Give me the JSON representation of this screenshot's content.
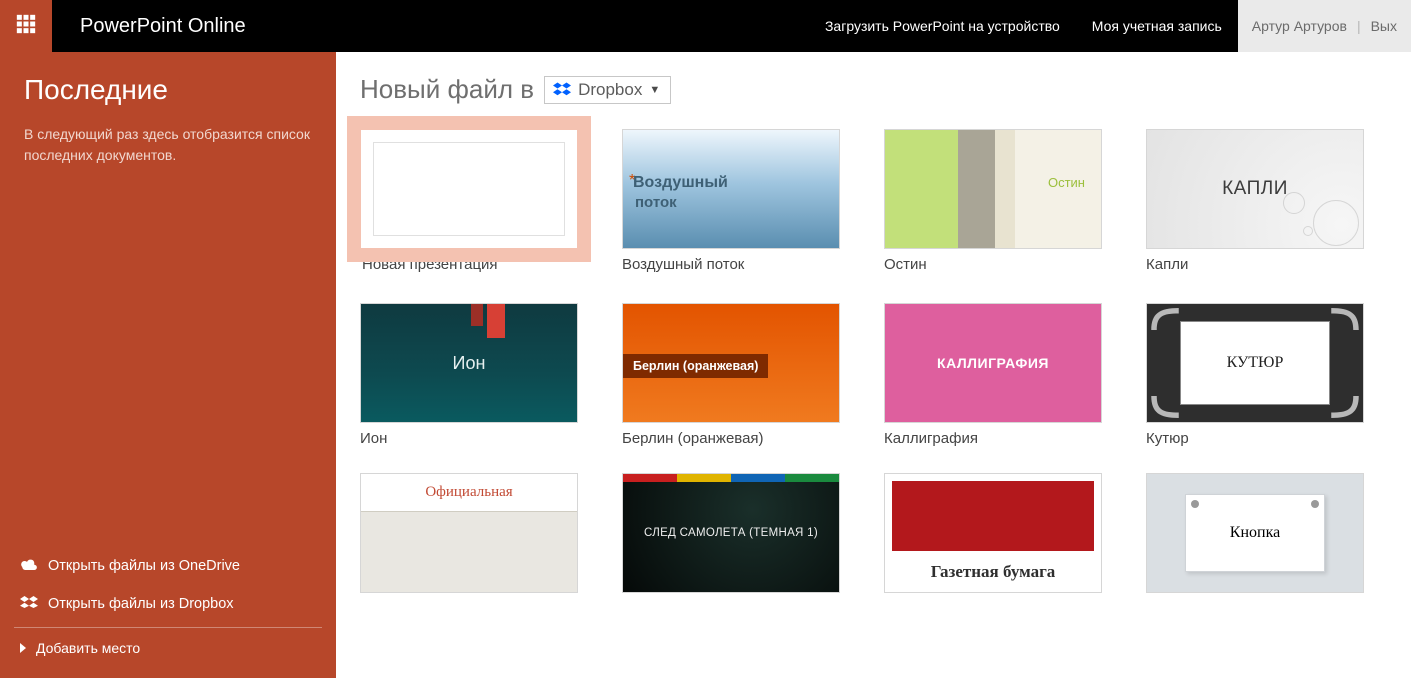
{
  "topbar": {
    "app_title": "PowerPoint Online",
    "download_link": "Загрузить PowerPoint на устройство",
    "account_link": "Моя учетная запись",
    "user_name": "Артур Артуров",
    "exit": "Вых"
  },
  "sidebar": {
    "recent_title": "Последние",
    "recent_message": "В следующий раз здесь отобразится список последних документов.",
    "open_onedrive": "Открыть файлы из OneDrive",
    "open_dropbox": "Открыть файлы из Dropbox",
    "add_place": "Добавить место"
  },
  "main": {
    "new_file_in": "Новый файл в",
    "location": "Dropbox"
  },
  "templates": [
    {
      "id": "blank",
      "label": "Новая презентация",
      "thumb_text": ""
    },
    {
      "id": "air",
      "label": "Воздушный поток",
      "thumb_text": "Воздушный поток",
      "thumb_text2": "поток",
      "asterisk": "*"
    },
    {
      "id": "austin",
      "label": "Остин",
      "thumb_text": "Остин"
    },
    {
      "id": "drops",
      "label": "Капли",
      "thumb_text": "КАПЛИ"
    },
    {
      "id": "ion",
      "label": "Ион",
      "thumb_text": "Ион"
    },
    {
      "id": "berlin",
      "label": "Берлин (оранжевая)",
      "thumb_text": "Берлин (оранжевая)"
    },
    {
      "id": "calli",
      "label": "Каллиграфия",
      "thumb_text": "КАЛЛИГРАФИЯ"
    },
    {
      "id": "couture",
      "label": "Кутюр",
      "thumb_text": "КУТЮР"
    },
    {
      "id": "official",
      "label": "",
      "thumb_text": "Официальная"
    },
    {
      "id": "trail",
      "label": "",
      "thumb_text": "СЛЕД САМОЛЕТА (ТЕМНАЯ 1)"
    },
    {
      "id": "news",
      "label": "",
      "thumb_text": "Газетная бумага"
    },
    {
      "id": "button",
      "label": "",
      "thumb_text": "Кнопка"
    }
  ]
}
